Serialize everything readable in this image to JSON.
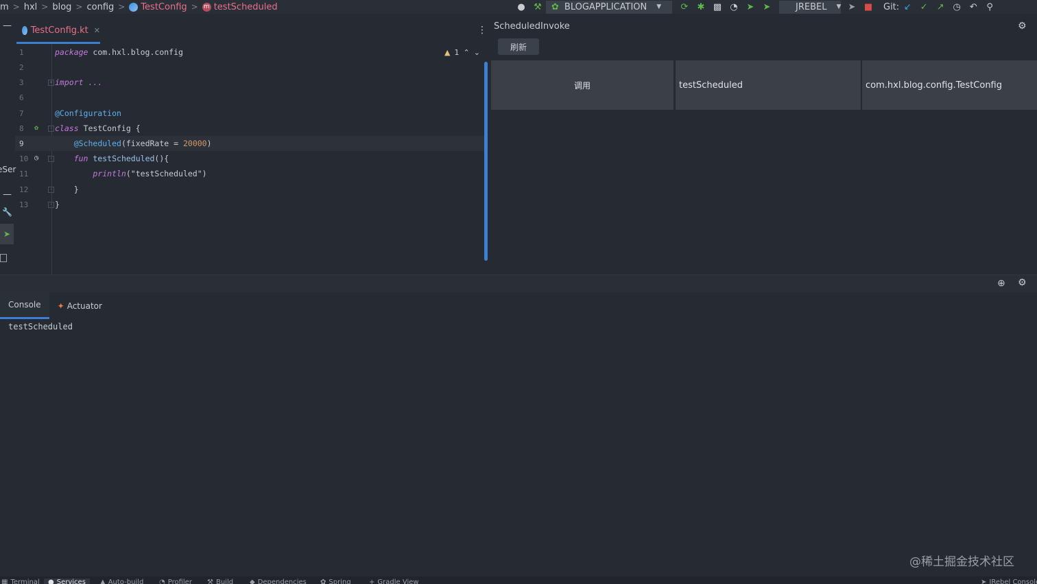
{
  "breadcrumb": {
    "items": [
      {
        "label": "m",
        "highlight": false
      },
      {
        "label": "hxl",
        "highlight": false
      },
      {
        "label": "blog",
        "highlight": false
      },
      {
        "label": "config",
        "highlight": false
      },
      {
        "label": "TestConfig",
        "highlight": true,
        "icon": "kotlin-class-icon"
      },
      {
        "label": "testScheduled",
        "highlight": true,
        "icon": "method-icon"
      }
    ]
  },
  "toolbar": {
    "run_config": "BLOGAPPLICATION",
    "jrebel": "JREBEL",
    "git_label": "Git:"
  },
  "editor": {
    "tab_label": "TestConfig.kt",
    "warning_count": "1",
    "lines": [
      {
        "n": "1"
      },
      {
        "n": "2"
      },
      {
        "n": "3"
      },
      {
        "n": "6"
      },
      {
        "n": "7"
      },
      {
        "n": "8"
      },
      {
        "n": "9"
      },
      {
        "n": "10"
      },
      {
        "n": "11"
      },
      {
        "n": "12"
      },
      {
        "n": "13"
      }
    ],
    "code": {
      "package_kw": "package",
      "package_name": " com.hxl.blog.config",
      "import_kw": "import",
      "import_rest": " ...",
      "configuration": "@Configuration",
      "class_kw": "class",
      "class_name": " TestConfig {",
      "scheduled_ann": "@Scheduled",
      "scheduled_args_open": "(fixedRate = ",
      "scheduled_num": "20000",
      "scheduled_args_close": ")",
      "fun_kw": "fun",
      "fun_name": " testScheduled",
      "fun_rest": "(){",
      "println_kw": "println",
      "println_arg": "(\"testScheduled\")",
      "close_inner": "}",
      "close_outer": "}"
    }
  },
  "left_strip": {
    "partial_text": "eSer"
  },
  "scheduled_panel": {
    "title": "ScheduledInvoke",
    "refresh_label": "刷新",
    "row": {
      "invoke_label": "调用",
      "method": "testScheduled",
      "class": "com.hxl.blog.config.TestConfig"
    }
  },
  "bottom": {
    "tabs": [
      {
        "label": "Console",
        "active": true
      },
      {
        "label": "Actuator",
        "active": false
      }
    ],
    "console_output": "testScheduled"
  },
  "watermark": "@稀土掘金技术社区",
  "statusbar": {
    "items": [
      {
        "label": "Terminal"
      },
      {
        "label": "Services",
        "active": true
      },
      {
        "label": "Auto-build"
      },
      {
        "label": "Profiler"
      },
      {
        "label": "Build"
      },
      {
        "label": "Dependencies"
      },
      {
        "label": "Spring"
      },
      {
        "label": "Gradle View"
      }
    ],
    "right": "JRebel Console"
  },
  "colors": {
    "background": "#262b33",
    "accent": "#3e7fd6",
    "highlight_text": "#e8708a"
  }
}
